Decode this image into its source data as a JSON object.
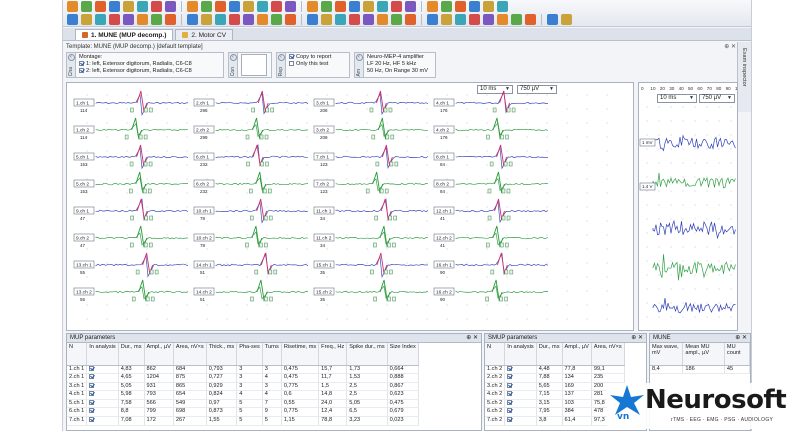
{
  "tabs": [
    {
      "label": "1. MUNE (MUP decomp.)",
      "active": true
    },
    {
      "label": "2. Motor CV",
      "active": false
    }
  ],
  "template": {
    "label": "Template: MUNE (MUP decomp.) [default template]"
  },
  "montage": {
    "title": "Montage:",
    "line1": "1: left, Extensor digitorum, Radialis, C6-C8",
    "line2": "2: left, Extensor digitorum, Radialis, C6-C8",
    "tab_label": "Cha"
  },
  "report": {
    "copy_label": "Copy to report",
    "only_label": "Only this test",
    "tab_label": "Rep",
    "copy_checked": true,
    "only_checked": false
  },
  "amplifier": {
    "name": "Neuro-MEP-4 amplifier",
    "filters": "LF 20 Hz, HF 5 kHz",
    "range": "50 Hz, On  Range 30 mV",
    "tab_label": "Am"
  },
  "mid_group": {
    "tab_label": "Con"
  },
  "side_tab": "Exam inspector",
  "main_wave": {
    "sweep": "10 ms",
    "sensitivity": "750 µV",
    "cells": [
      {
        "label": "1.ch 1",
        "num": "114"
      },
      {
        "label": "2.ch 1",
        "num": "295"
      },
      {
        "label": "3.ch 1",
        "num": "206"
      },
      {
        "label": "4.ch 1",
        "num": "176"
      },
      {
        "label": "1.ch 2",
        "num": "114"
      },
      {
        "label": "2.ch 2",
        "num": "295"
      },
      {
        "label": "3.ch 2",
        "num": "206"
      },
      {
        "label": "4.ch 2",
        "num": "176"
      },
      {
        "label": "5.ch 1",
        "num": "153"
      },
      {
        "label": "6.ch 1",
        "num": "232"
      },
      {
        "label": "7.ch 1",
        "num": "123"
      },
      {
        "label": "8.ch 1",
        "num": "84"
      },
      {
        "label": "5.ch 2",
        "num": "153"
      },
      {
        "label": "6.ch 2",
        "num": "232"
      },
      {
        "label": "7.ch 2",
        "num": "123"
      },
      {
        "label": "8.ch 2",
        "num": "84"
      },
      {
        "label": "9.ch 1",
        "num": "47"
      },
      {
        "label": "10.ch 1",
        "num": "78"
      },
      {
        "label": "11.ch 1",
        "num": "34"
      },
      {
        "label": "12.ch 1",
        "num": "41"
      },
      {
        "label": "9.ch 2",
        "num": "47"
      },
      {
        "label": "10.ch 2",
        "num": "78"
      },
      {
        "label": "11.ch 2",
        "num": "34"
      },
      {
        "label": "12.ch 2",
        "num": "41"
      },
      {
        "label": "13.ch 1",
        "num": "55"
      },
      {
        "label": "14.ch 1",
        "num": "51"
      },
      {
        "label": "15.ch 1",
        "num": "35"
      },
      {
        "label": "16.ch 1",
        "num": "90"
      },
      {
        "label": "13.ch 2",
        "num": "55"
      },
      {
        "label": "14.ch 2",
        "num": "51"
      },
      {
        "label": "15.ch 2",
        "num": "35"
      },
      {
        "label": "16.ch 2",
        "num": "90"
      }
    ]
  },
  "right_wave": {
    "sweep": "10 ms",
    "sensitivity": "750 µV",
    "ticks": [
      "0",
      "10",
      "20",
      "30",
      "40",
      "50",
      "60",
      "70",
      "80",
      "90",
      "100"
    ],
    "ch1_label": "1 mV",
    "ch2_label": "1.4 V"
  },
  "mup": {
    "title": "MUP parameters",
    "headers": [
      "N",
      "In analysis",
      "Dur., ms",
      "Ampl., µV",
      "Area, nV×s",
      "Thick., ms",
      "Pha-ses",
      "Turns",
      "Risetime, ms",
      "Freq., Hz",
      "Spike dur., ms",
      "Size Index"
    ],
    "rows": [
      [
        "1.ch 1",
        "4,83",
        "862",
        "684",
        "0,793",
        "3",
        "3",
        "0,475",
        "15,7",
        "1,73",
        "0,664"
      ],
      [
        "2.ch 1",
        "4,65",
        "1204",
        "875",
        "0,727",
        "3",
        "4",
        "0,475",
        "11,7",
        "1,53",
        "0,888"
      ],
      [
        "3.ch 1",
        "5,05",
        "931",
        "865",
        "0,929",
        "3",
        "3",
        "0,775",
        "1,5",
        "2,5",
        "0,867"
      ],
      [
        "4.ch 1",
        "5,98",
        "793",
        "654",
        "0,824",
        "4",
        "4",
        "0,6",
        "14,8",
        "2,5",
        "0,623"
      ],
      [
        "5.ch 1",
        "7,58",
        "566",
        "549",
        "0,97",
        "5",
        "7",
        "0,55",
        "24,0",
        "5,05",
        "0,475"
      ],
      [
        "6.ch 1",
        "8,8",
        "799",
        "698",
        "0,873",
        "5",
        "9",
        "0,775",
        "12,4",
        "6,5",
        "0,679"
      ],
      [
        "7.ch 1",
        "7,08",
        "172",
        "267",
        "1,55",
        "5",
        "5",
        "1,15",
        "78,8",
        "3,23",
        "0,023"
      ]
    ]
  },
  "smup": {
    "title": "SMUP parameters",
    "headers": [
      "N",
      "In analysis",
      "Dur., ms",
      "Ampl., µV",
      "Area, nV×s"
    ],
    "rows": [
      [
        "1.ch 2",
        "4,48",
        "77,8",
        "99,1"
      ],
      [
        "2.ch 2",
        "7,88",
        "134",
        "235"
      ],
      [
        "3.ch 2",
        "5,65",
        "169",
        "200"
      ],
      [
        "4.ch 2",
        "7,15",
        "137",
        "281"
      ],
      [
        "5.ch 2",
        "3,15",
        "103",
        "75,8"
      ],
      [
        "6.ch 2",
        "7,95",
        "384",
        "478"
      ],
      [
        "7.ch 2",
        "3,8",
        "61,4",
        "97,3"
      ]
    ]
  },
  "mune": {
    "title": "MUNE",
    "headers": [
      "Max wave, mV",
      "Mean MU ampl., µV",
      "MU count"
    ],
    "row": [
      "8,4",
      "186",
      "45"
    ]
  },
  "logo": {
    "name": "Neurosoft",
    "region": "vn",
    "tagline": "rTMS · EEG · EMG · PSG · AUDIOLOGY"
  },
  "colors": {
    "trace_ch1": "#d0306e",
    "trace_ch2": "#2a9a3a",
    "trace_blue": "#2f3fb8",
    "trace_green": "#34a14a",
    "logo_blue": "#1478d4"
  }
}
